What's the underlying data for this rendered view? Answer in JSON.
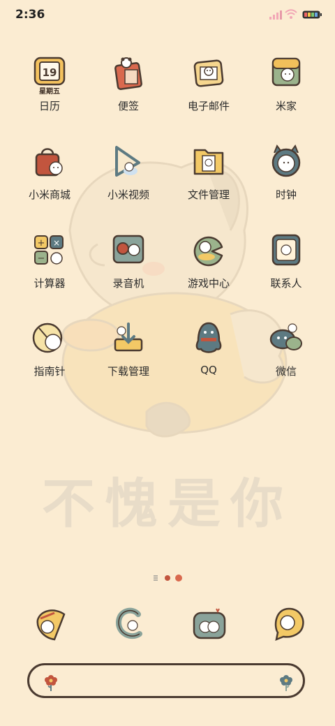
{
  "status": {
    "time": "2:36"
  },
  "apps": [
    {
      "label": "日历"
    },
    {
      "label": "便签"
    },
    {
      "label": "电子邮件"
    },
    {
      "label": "米家"
    },
    {
      "label": "小米商城"
    },
    {
      "label": "小米视频"
    },
    {
      "label": "文件管理"
    },
    {
      "label": "时钟"
    },
    {
      "label": "计算器"
    },
    {
      "label": "录音机"
    },
    {
      "label": "游戏中心"
    },
    {
      "label": "联系人"
    },
    {
      "label": "指南针"
    },
    {
      "label": "下载管理"
    },
    {
      "label": "QQ"
    },
    {
      "label": "微信"
    }
  ],
  "calendar_icon": {
    "day": "19",
    "weekday": "星期五"
  },
  "wallpaper_text": "不愧是你",
  "colors": {
    "background": "#fbecd2",
    "outline": "#4a3a30"
  }
}
